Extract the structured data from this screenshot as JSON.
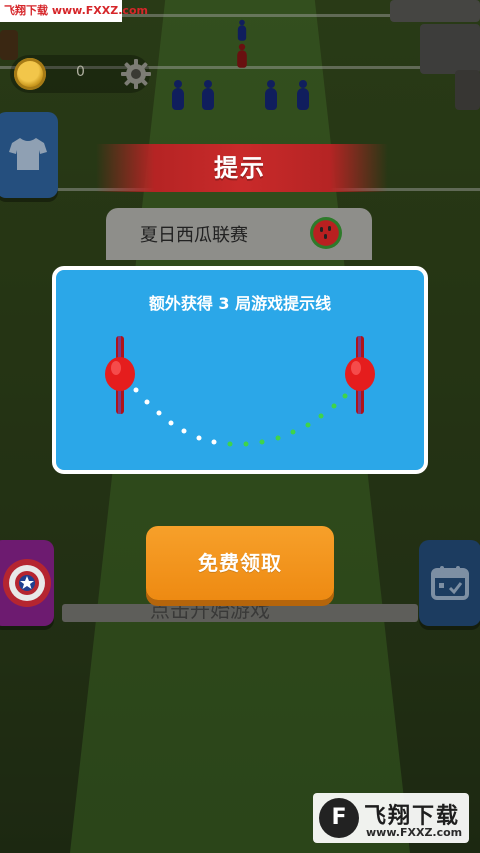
{
  "watermark_top": "飞翔下载 www.FXXZ.com",
  "coins": {
    "count": "0"
  },
  "banner": {
    "title": "提示"
  },
  "card_behind": {
    "title": "夏日西瓜联赛"
  },
  "dialog": {
    "message": "额外获得 3 局游戏提示线"
  },
  "claim_button": {
    "label": "免费领取"
  },
  "faded_text": "点击开始游戏",
  "watermark_br": {
    "logo": "F",
    "cn": "飞翔下载",
    "url": "www.FXXZ.com"
  },
  "colors": {
    "dialog_bg": "#2ba7e8",
    "claim_bg": "#f7a02a",
    "banner_red": "#c92a2a",
    "paddle_red": "#e51d1d",
    "dot_green": "#3fd44a"
  }
}
